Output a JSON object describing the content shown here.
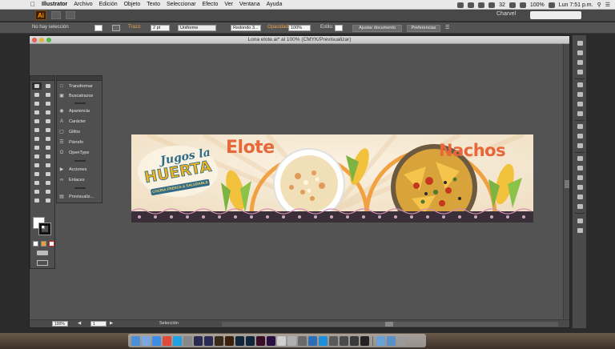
{
  "menubar": {
    "app_name": "Illustrator",
    "items": [
      "Archivo",
      "Edición",
      "Objeto",
      "Texto",
      "Seleccionar",
      "Efecto",
      "Ver",
      "Ventana",
      "Ayuda"
    ],
    "badge": "32",
    "battery": "100%",
    "clock": "Lun 7:51 p.m."
  },
  "appbar": {
    "logo": "Ai",
    "workspace": "Charvel"
  },
  "controlbar": {
    "selection": "No hay selección",
    "stroke_label": "Trazo:",
    "stroke_weight": "2 pt",
    "stroke_profile": "Uniforme",
    "brush": "Redondo 3...",
    "opacity_label": "Opacidad:",
    "opacity_value": "100%",
    "style_label": "Estilo:",
    "adjust_doc": "Ajustar documento",
    "preferences": "Preferencias"
  },
  "document": {
    "title": "Lona elote.ai* al 100% (CMYK/Previsualizar)"
  },
  "statusbar": {
    "zoom": "100%",
    "page": "1",
    "tool": "Selección"
  },
  "banner": {
    "word_left": "Elote",
    "word_right": "Nachos",
    "logo_line1": "Jugos la",
    "logo_line2": "HUERTA",
    "logo_tagline": "COCINA FRESCA & SALUDABLE"
  },
  "panels": {
    "items": [
      {
        "label": "Transformar",
        "icon": "transform-icon"
      },
      {
        "label": "Buscatrazos",
        "icon": "pathfinder-icon"
      },
      {
        "label": "Apariencia",
        "icon": "appearance-icon"
      },
      {
        "label": "Carácter",
        "icon": "character-icon"
      },
      {
        "label": "Glifos",
        "icon": "glyphs-icon"
      },
      {
        "label": "Párrafo",
        "icon": "paragraph-icon"
      },
      {
        "label": "OpenType",
        "icon": "opentype-icon"
      },
      {
        "label": "Acciones",
        "icon": "actions-icon"
      },
      {
        "label": "Enlaces",
        "icon": "links-icon"
      },
      {
        "label": "Previsualiz...",
        "icon": "preview-icon"
      }
    ]
  },
  "colors": {
    "orange_text": "#e8673a",
    "logo_blue": "#2f6b86",
    "logo_yellow": "#f2b31c",
    "banner_bg": "#f3eadb"
  }
}
